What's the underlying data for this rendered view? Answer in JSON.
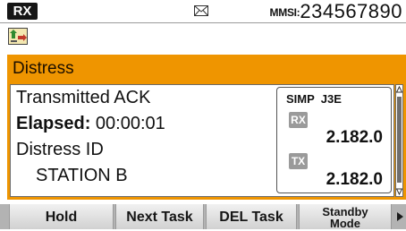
{
  "status_bar": {
    "mode": "RX",
    "mail_icon": "envelope-icon",
    "mmsi_label": "MMSI:",
    "mmsi_value": "234567890"
  },
  "sub_status": {
    "icon": "tx-status-icon"
  },
  "panel": {
    "title": "Distress",
    "status_line": "Transmitted ACK",
    "elapsed_label": "Elapsed:",
    "elapsed_value": "00:00:01",
    "id_label": "Distress ID",
    "station": "STATION B",
    "accent_color": "#ef9500"
  },
  "channel": {
    "mode_a": "SIMP",
    "mode_b": "J3E",
    "rx_label": "RX",
    "rx_freq": "2.182.0",
    "tx_label": "TX",
    "tx_freq": "2.182.0"
  },
  "softkeys": {
    "hold": "Hold",
    "next_task": "Next Task",
    "del_task": "DEL Task",
    "standby_line1": "Standby",
    "standby_line2": "Mode",
    "more_icon": "arrow-right-icon"
  }
}
